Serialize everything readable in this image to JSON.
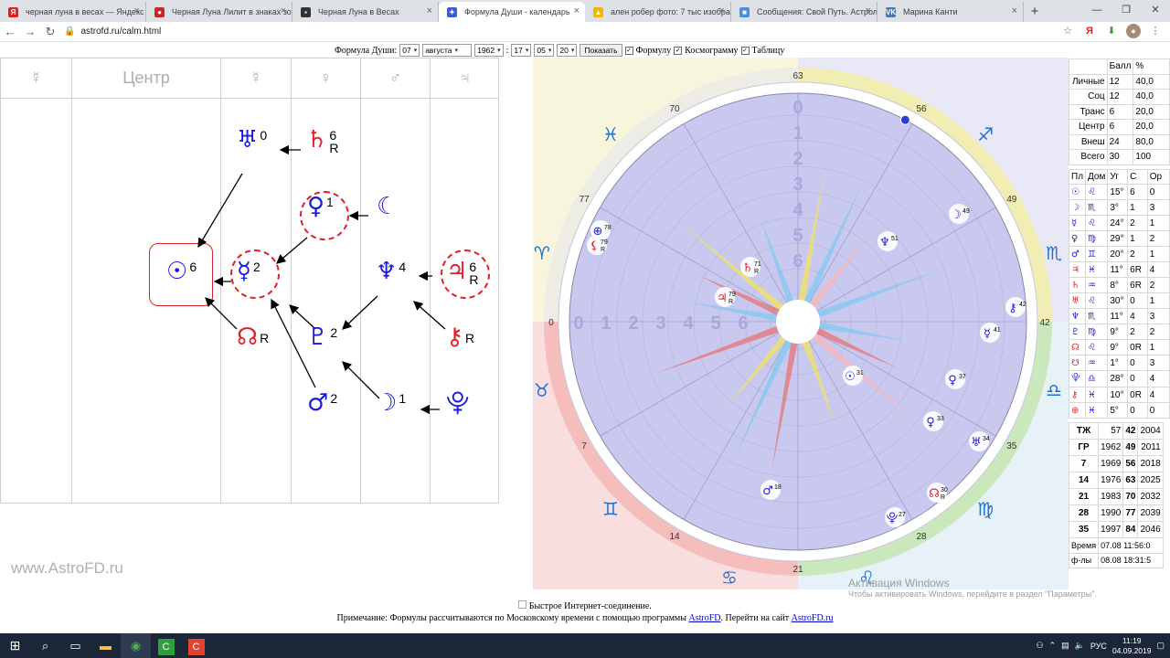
{
  "browser": {
    "tabs": [
      {
        "label": "черная луна в весах — Яндекс",
        "favicon": "Я",
        "favicon_color": "#e02020",
        "active": false
      },
      {
        "label": "Черная Луна Лилит в знаках зо",
        "favicon": "●",
        "favicon_color": "#c62828",
        "active": false
      },
      {
        "label": "Черная Луна в Весах",
        "favicon": "▪",
        "favicon_color": "#333333",
        "active": false
      },
      {
        "label": "Формула Души - календарь",
        "favicon": "✦",
        "favicon_color": "#3b5bdb",
        "active": true
      },
      {
        "label": "ален робер фото: 7 тыс изображ",
        "favicon": "▲",
        "favicon_color": "#f2b600",
        "active": false
      },
      {
        "label": "Сообщения: Свой Путь. Астрол",
        "favicon": "■",
        "favicon_color": "#4a90d9",
        "active": false
      },
      {
        "label": "Марина Канти",
        "favicon": "VK",
        "favicon_color": "#4a76a8",
        "active": false
      }
    ],
    "url": "astrofd.ru/calm.html"
  },
  "form": {
    "label": "Формула Души:",
    "day": "07",
    "month": "августа",
    "year": "1962",
    "hour": "17",
    "minute": "05",
    "second": "20",
    "submit": "Показать",
    "opt_formula": "Формулу",
    "opt_cosmogram": "Космограмму",
    "opt_table": "Таблицу"
  },
  "formula": {
    "headers": [
      "☿",
      "Центр",
      "☿",
      "♀",
      "♂",
      "♃"
    ],
    "nodes": [
      {
        "id": "uranus",
        "glyph": "♅",
        "color": "#1a1adb",
        "num": "0",
        "r": ""
      },
      {
        "id": "saturn",
        "glyph": "♄",
        "color": "#e0202a",
        "num": "6",
        "r": "R"
      },
      {
        "id": "venus",
        "glyph": "♀",
        "color": "#1a1adb",
        "num": "1",
        "r": ""
      },
      {
        "id": "moon-top",
        "glyph": "☾",
        "color": "#1a1adb",
        "num": "",
        "r": ""
      },
      {
        "id": "sun",
        "glyph": "☉",
        "color": "#1a1adb",
        "num": "6",
        "r": ""
      },
      {
        "id": "mercury",
        "glyph": "☿",
        "color": "#1a1adb",
        "num": "2",
        "r": ""
      },
      {
        "id": "neptune",
        "glyph": "♆",
        "color": "#1a1adb",
        "num": "4",
        "r": ""
      },
      {
        "id": "jupiter",
        "glyph": "♃",
        "color": "#e0202a",
        "num": "6",
        "r": "R"
      },
      {
        "id": "node",
        "glyph": "☊",
        "color": "#e0202a",
        "num": "",
        "r": "R"
      },
      {
        "id": "pluto",
        "glyph": "♇",
        "color": "#1a1adb",
        "num": "2",
        "r": ""
      },
      {
        "id": "chiron",
        "glyph": "⚷",
        "color": "#e0202a",
        "num": "",
        "r": "R"
      },
      {
        "id": "mars",
        "glyph": "♂",
        "color": "#1a1adb",
        "num": "2",
        "r": ""
      },
      {
        "id": "moon-bottom",
        "glyph": "☽",
        "color": "#1a1adb",
        "num": "1",
        "r": ""
      },
      {
        "id": "proserpina",
        "glyph": "⯓",
        "color": "#1a1adb",
        "num": "",
        "r": ""
      }
    ],
    "site": "www.AstroFD.ru"
  },
  "chart": {
    "outer_numbers": [
      "63",
      "56",
      "49",
      "42",
      "35",
      "28",
      "21",
      "14",
      "7",
      "0",
      "77",
      "70"
    ],
    "signs": [
      "♒",
      "♐",
      "♏",
      "♎",
      "♍",
      "♌",
      "♋",
      "♊",
      "♉",
      "♈",
      "♓",
      "♑"
    ],
    "inner_scale": [
      "0",
      "1",
      "2",
      "3",
      "4",
      "5",
      "6"
    ],
    "planets": [
      {
        "glyph": "♄",
        "deg": "71",
        "r": "R"
      },
      {
        "glyph": "♃",
        "deg": "79",
        "r": "R"
      },
      {
        "glyph": "♆",
        "deg": "51",
        "r": ""
      },
      {
        "glyph": "☽",
        "deg": "49",
        "r": ""
      },
      {
        "glyph": "⚷",
        "deg": "42",
        "r": ""
      },
      {
        "glyph": "☿",
        "deg": "41",
        "r": ""
      },
      {
        "glyph": "♀",
        "deg": "37",
        "r": ""
      },
      {
        "glyph": "☉",
        "deg": "31",
        "r": ""
      },
      {
        "glyph": "♀",
        "deg": "33",
        "r": ""
      },
      {
        "glyph": "♅",
        "deg": "34",
        "r": ""
      },
      {
        "glyph": "♂",
        "deg": "18",
        "r": ""
      },
      {
        "glyph": "☊",
        "deg": "30",
        "r": "R"
      },
      {
        "glyph": "⯓",
        "deg": "27",
        "r": ""
      },
      {
        "glyph": "⊕",
        "deg": "78",
        "r": ""
      },
      {
        "glyph": "⚸",
        "deg": "79",
        "r": "R"
      }
    ]
  },
  "score_table": {
    "header": [
      "",
      "Балл",
      "%"
    ],
    "rows": [
      [
        "Личные",
        "12",
        "40,0"
      ],
      [
        "Соц",
        "12",
        "40,0"
      ],
      [
        "Транс",
        "6",
        "20,0"
      ],
      [
        "Центр",
        "6",
        "20,0"
      ],
      [
        "Внеш",
        "24",
        "80,0"
      ],
      [
        "Всего",
        "30",
        "100"
      ]
    ]
  },
  "planet_table": {
    "header": [
      "Пл",
      "Дом",
      "Уг",
      "С",
      "Ор"
    ],
    "rows": [
      [
        "☉",
        "♌",
        "15°",
        "6",
        "0"
      ],
      [
        "☽",
        "♏",
        "3°",
        "1",
        "3"
      ],
      [
        "☿",
        "♌",
        "24°",
        "2",
        "1"
      ],
      [
        "♀",
        "♍",
        "29°",
        "1",
        "2"
      ],
      [
        "♂",
        "♊",
        "20°",
        "2",
        "1"
      ],
      [
        "♃",
        "♓",
        "11°",
        "6R",
        "4"
      ],
      [
        "♄",
        "♒",
        "8°",
        "6R",
        "2"
      ],
      [
        "♅",
        "♌",
        "30°",
        "0",
        "1"
      ],
      [
        "♆",
        "♏",
        "11°",
        "4",
        "3"
      ],
      [
        "♇",
        "♍",
        "9°",
        "2",
        "2"
      ],
      [
        "☊",
        "♌",
        "9°",
        "0R",
        "1"
      ],
      [
        "☋",
        "♒",
        "1°",
        "0",
        "3"
      ],
      [
        "⯓",
        "♎",
        "28°",
        "0",
        "4"
      ],
      [
        "⚷",
        "♓",
        "10°",
        "0R",
        "4"
      ],
      [
        "⊕",
        "♓",
        "5°",
        "0",
        "0"
      ]
    ]
  },
  "age_table": {
    "rows": [
      [
        "ТЖ",
        "57",
        "42",
        "2004"
      ],
      [
        "ГР",
        "1962",
        "49",
        "2011"
      ],
      [
        "7",
        "1969",
        "56",
        "2018"
      ],
      [
        "14",
        "1976",
        "63",
        "2025"
      ],
      [
        "21",
        "1983",
        "70",
        "2032"
      ],
      [
        "28",
        "1990",
        "77",
        "2039"
      ],
      [
        "35",
        "1997",
        "84",
        "2046"
      ]
    ],
    "time_label": "Время",
    "time_value": "07.08 11:56:0",
    "fl_label": "ф-лы",
    "fl_value": "08.08 18:31:5"
  },
  "footer": {
    "fast_internet": "Быстрое Интернет-соединение.",
    "note_prefix": "Примечание: Формулы рассчитываются по Московскому времени с помощью программы",
    "astrofd_link": "AstroFD",
    "note_middle": ". Перейти на сайт",
    "site_link": "AstroFD.ru"
  },
  "windows": {
    "activation_title": "Активация Windows",
    "activation_text": "Чтобы активировать Windows, перейдите в раздел \"Параметры\".",
    "lang": "РУС",
    "time": "11:19",
    "date": "04.09.2019"
  }
}
